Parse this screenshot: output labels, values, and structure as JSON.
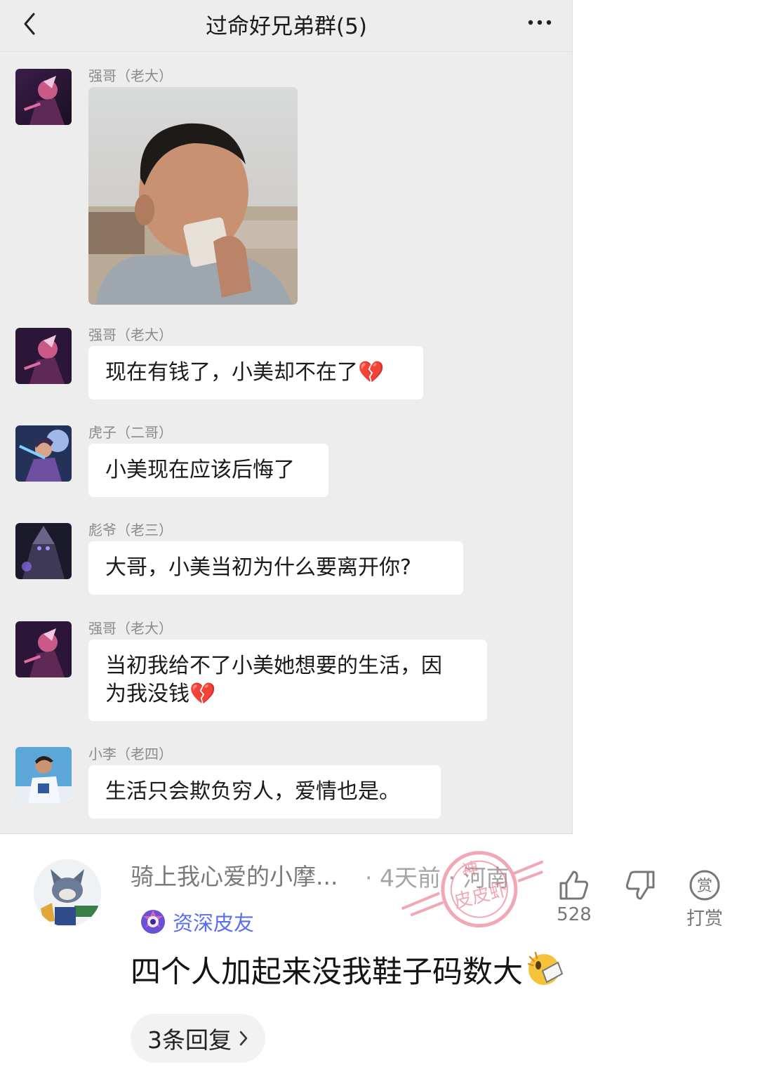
{
  "chat": {
    "title": "过命好兄弟群(5)",
    "messages": [
      {
        "sender": "强哥（老大）",
        "type": "image"
      },
      {
        "sender": "强哥（老大）",
        "text": "现在有钱了，小美却不在了💔"
      },
      {
        "sender": "虎子（二哥）",
        "text": "小美现在应该后悔了"
      },
      {
        "sender": "彪爷（老三）",
        "text": "大哥，小美当初为什么要离开你?"
      },
      {
        "sender": "强哥（老大）",
        "text_line1": "当初我给不了小美她想要的生活，因",
        "text_line2": "为我没钱💔"
      },
      {
        "sender": "小李（老四）",
        "text": "生活只会欺负穷人，爱情也是。"
      }
    ]
  },
  "comment": {
    "username": "骑上我心爱的小摩...",
    "meta": "· 4天前 · 河南",
    "badge": "资深皮友",
    "text": "四个人加起来没我鞋子码数大",
    "like_count": "528",
    "reward_label": "打赏",
    "reward_icon_char": "赏",
    "replies_label": "3条回复"
  },
  "watermark": {
    "text": "皮皮虾",
    "top": "神"
  },
  "colors": {
    "badge": "#5a6cf0",
    "chat_bg": "#ededed",
    "bubble": "#ffffff",
    "watermark": "#e8607a"
  }
}
